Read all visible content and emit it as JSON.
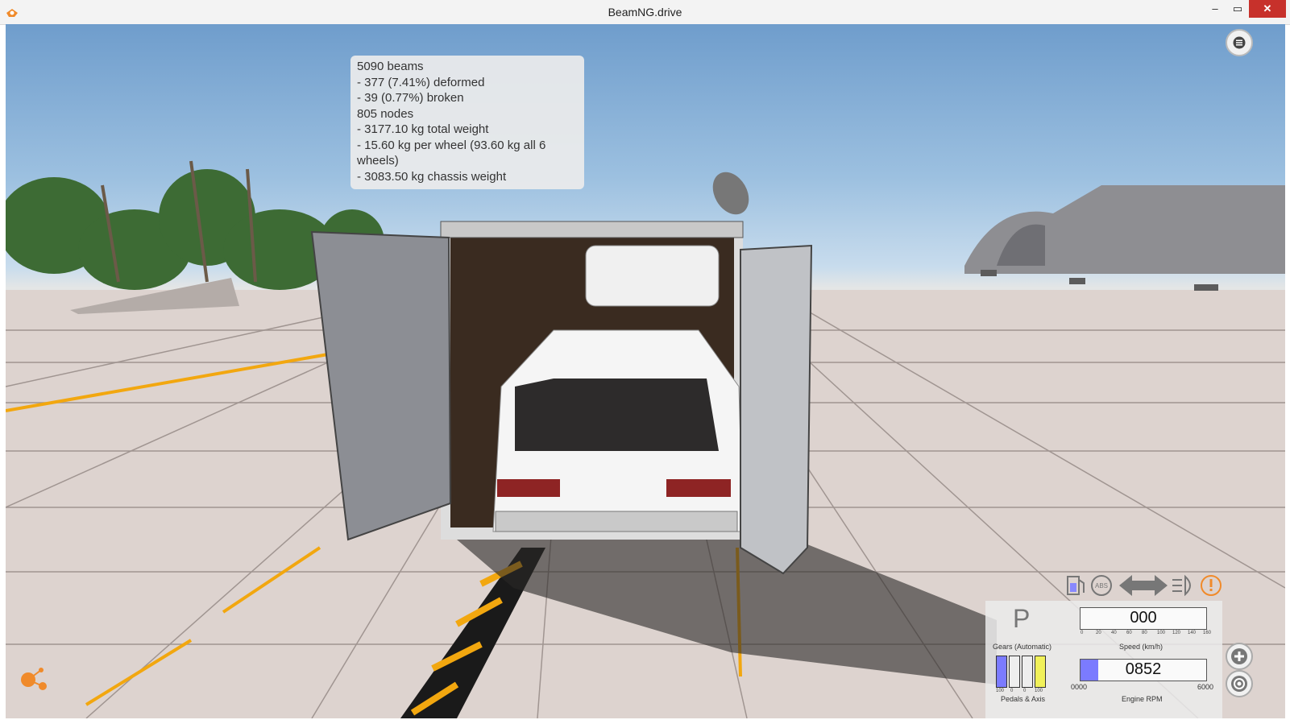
{
  "window": {
    "title": "BeamNG.drive",
    "minimize_glyph": "–",
    "maximize_glyph": "▭",
    "close_glyph": "✕"
  },
  "stats": {
    "lines": [
      "5090 beams",
      "- 377 (7.41%) deformed",
      "- 39 (0.77%) broken",
      "805 nodes",
      "- 3177.10 kg total weight",
      "- 15.60 kg per wheel (93.60 kg all 6 wheels)",
      "- 3083.50 kg chassis weight"
    ]
  },
  "dashboard": {
    "gear": "P",
    "gear_label": "Gears (Automatic)",
    "speed_value": "000",
    "speed_label": "Speed (km/h)",
    "speed_ticks": [
      "0",
      "20",
      "40",
      "60",
      "80",
      "100",
      "120",
      "140",
      "160"
    ],
    "rpm_value": "0852",
    "rpm_label": "Engine RPM",
    "rpm_min": "0000",
    "rpm_max": "6000",
    "rpm_fraction": 0.142,
    "pedals_label": "Pedals & Axis",
    "pedal_ticks": [
      "100",
      "0",
      "0",
      "100"
    ],
    "pedal_colors": [
      "#7b7bff",
      "#eeeeee",
      "#eeeeee",
      "#f1f15a"
    ]
  },
  "indicators": [
    "fuel-icon",
    "abs-icon",
    "left-signal-icon",
    "right-signal-icon",
    "headlight-icon",
    "warning-icon"
  ],
  "colors": {
    "accent_orange": "#f08a2a",
    "close_red": "#c7312b",
    "rpm_fill": "#7b7bff"
  }
}
